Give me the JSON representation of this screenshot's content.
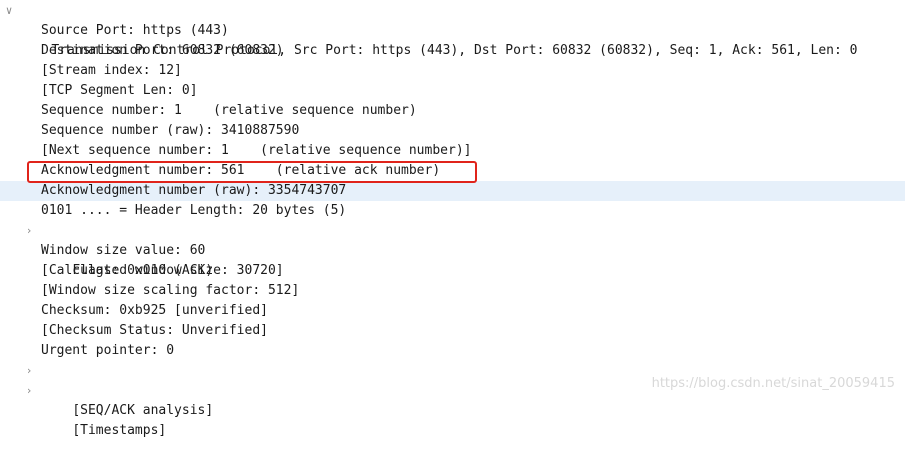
{
  "header": {
    "label": "Transmission Control Protocol, Src Port: https (443), Dst Port: 60832 (60832), Seq: 1, Ack: 561, Len: 0",
    "toggle": "∨"
  },
  "fields": [
    {
      "label": "Source Port: https (443)",
      "toggle": ""
    },
    {
      "label": "Destination Port: 60832 (60832)",
      "toggle": ""
    },
    {
      "label": "[Stream index: 12]",
      "toggle": ""
    },
    {
      "label": "[TCP Segment Len: 0]",
      "toggle": ""
    },
    {
      "label": "Sequence number: 1    (relative sequence number)",
      "toggle": ""
    },
    {
      "label": "Sequence number (raw): 3410887590",
      "toggle": ""
    },
    {
      "label": "[Next sequence number: 1    (relative sequence number)]",
      "toggle": ""
    },
    {
      "label": "Acknowledgment number: 561    (relative ack number)",
      "toggle": ""
    },
    {
      "label": "Acknowledgment number (raw): 3354743707",
      "toggle": ""
    },
    {
      "label": "0101 .... = Header Length: 20 bytes (5)",
      "toggle": ""
    },
    {
      "label": "Flags: 0x010 (ACK)",
      "toggle": "›"
    },
    {
      "label": "Window size value: 60",
      "toggle": ""
    },
    {
      "label": "[Calculated window size: 30720]",
      "toggle": ""
    },
    {
      "label": "[Window size scaling factor: 512]",
      "toggle": ""
    },
    {
      "label": "Checksum: 0xb925 [unverified]",
      "toggle": ""
    },
    {
      "label": "[Checksum Status: Unverified]",
      "toggle": ""
    },
    {
      "label": "Urgent pointer: 0",
      "toggle": ""
    },
    {
      "label": "[SEQ/ACK analysis]",
      "toggle": "›"
    },
    {
      "label": "[Timestamps]",
      "toggle": "›"
    }
  ],
  "watermark": "https://blog.csdn.net/sinat_20059415",
  "colors": {
    "highlight_row": "#e6f0fa",
    "annotation_box": "#e0241b"
  }
}
